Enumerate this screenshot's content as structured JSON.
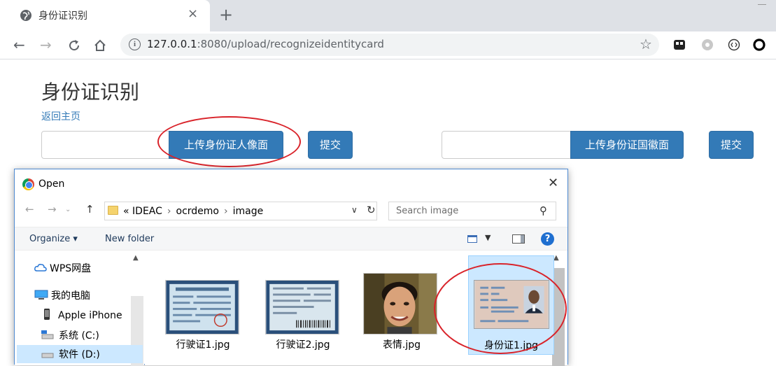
{
  "browser": {
    "tab_title": "身份证识别",
    "tab_close": "×",
    "new_tab": "+",
    "url_host": "127.0.0.1",
    "url_rest": ":8080/upload/recognizeidentitycard"
  },
  "page": {
    "title": "身份证识别",
    "back_link": "返回主页",
    "upload_front_label": "上传身份证人像面",
    "submit_label": "提交",
    "upload_back_label": "上传身份证国徽面"
  },
  "dialog": {
    "title": "Open",
    "path": [
      "«",
      "IDEAC",
      "ocrdemo",
      "image"
    ],
    "search_placeholder": "Search image",
    "organize_label": "Organize ▾",
    "new_folder_label": "New folder",
    "nav_items": [
      {
        "label": "WPS网盘",
        "icon": "cloud-icon"
      },
      {
        "label": "我的电脑",
        "icon": "computer-icon"
      },
      {
        "label": "Apple iPhone",
        "icon": "phone-icon"
      },
      {
        "label": "系统 (C:)",
        "icon": "drive-icon"
      },
      {
        "label": "软件 (D:)",
        "icon": "drive-icon"
      }
    ],
    "files": [
      {
        "name": "行驶证1.jpg",
        "kind": "vehicle-license"
      },
      {
        "name": "行驶证2.jpg",
        "kind": "vehicle-license"
      },
      {
        "name": "表情.jpg",
        "kind": "portrait"
      },
      {
        "name": "身份证1.jpg",
        "kind": "id-card",
        "selected": true
      }
    ]
  },
  "colors": {
    "primary_button": "#337ab7",
    "link": "#337ab7",
    "annotation_red": "#d9232a",
    "selection": "#cce8ff"
  }
}
